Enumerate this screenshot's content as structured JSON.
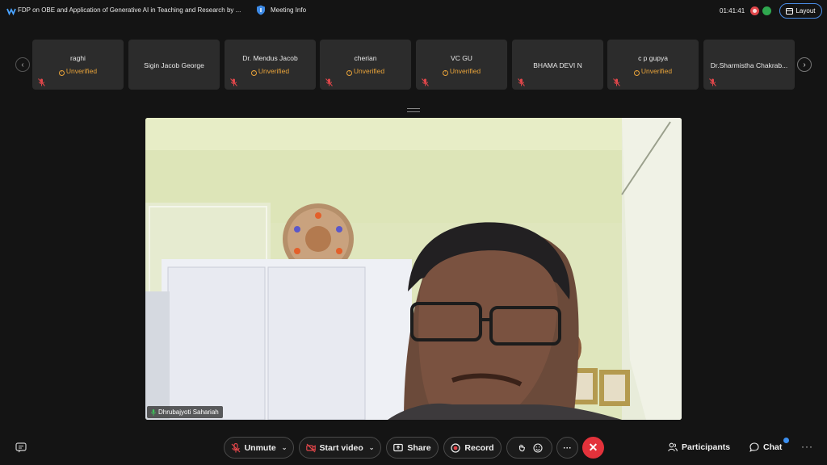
{
  "topbar": {
    "meeting_title": "FDP on OBE and Application of Generative AI in Teaching and Research by ...",
    "meeting_info_label": "Meeting Info",
    "timer": "01:41:41",
    "layout_label": "Layout"
  },
  "participants": [
    {
      "name": "raghi",
      "status": "Unverified"
    },
    {
      "name": "Sigin Jacob George",
      "status": ""
    },
    {
      "name": "Dr. Mendus Jacob",
      "status": "Unverified"
    },
    {
      "name": "cherian",
      "status": "Unverified"
    },
    {
      "name": "VC GU",
      "status": "Unverified"
    },
    {
      "name": "BHAMA DEVI N",
      "status": ""
    },
    {
      "name": "c p gupya",
      "status": "Unverified"
    },
    {
      "name": "Dr.Sharmistha Chakrab...",
      "status": ""
    }
  ],
  "video": {
    "speaker_name": "Dhrubajyoti Sahariah"
  },
  "toolbar": {
    "unmute_label": "Unmute",
    "start_video_label": "Start video",
    "share_label": "Share",
    "record_label": "Record",
    "participants_label": "Participants",
    "chat_label": "Chat"
  },
  "colors": {
    "background": "#141414",
    "tile": "#2c2c2c",
    "accent": "#4a8de8",
    "warning": "#e8a33a",
    "end_call": "#e3323b",
    "muted_icon": "#e0464a"
  }
}
